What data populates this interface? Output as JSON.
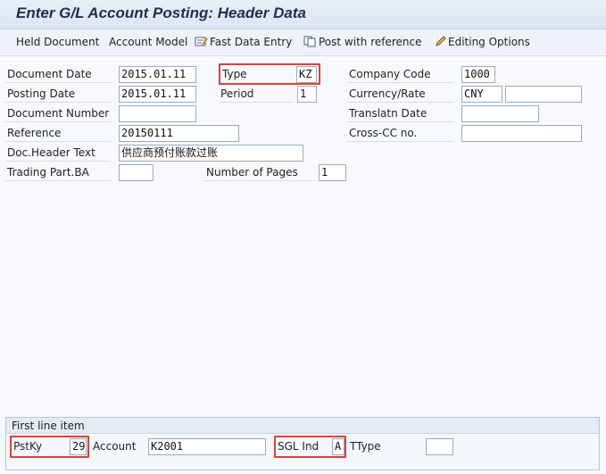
{
  "window": {
    "title": "Enter G/L Account Posting: Header Data"
  },
  "toolbar": {
    "held_document": "Held Document",
    "account_model": "Account Model",
    "fast_data_entry": "Fast Data Entry",
    "post_with_reference": "Post with reference",
    "editing_options": "Editing Options"
  },
  "header": {
    "document_date": {
      "label": "Document Date",
      "value": "2015.01.11"
    },
    "type": {
      "label": "Type",
      "value": "KZ"
    },
    "company_code": {
      "label": "Company Code",
      "value": "1000"
    },
    "posting_date": {
      "label": "Posting Date",
      "value": "2015.01.11"
    },
    "period": {
      "label": "Period",
      "value": "1"
    },
    "currency_rate": {
      "label": "Currency/Rate",
      "currency": "CNY",
      "rate": ""
    },
    "document_number": {
      "label": "Document Number",
      "value": ""
    },
    "translatn_date": {
      "label": "Translatn Date",
      "value": ""
    },
    "reference": {
      "label": "Reference",
      "value": "20150111"
    },
    "cross_cc_no": {
      "label": "Cross-CC no.",
      "value": ""
    },
    "doc_header_text": {
      "label": "Doc.Header Text",
      "value": "供应商预付账款过账"
    },
    "trading_part_ba": {
      "label": "Trading Part.BA",
      "value": ""
    },
    "number_of_pages": {
      "label": "Number of Pages",
      "value": "1"
    }
  },
  "first_line_item": {
    "title": "First line item",
    "pstky": {
      "label": "PstKy",
      "value": "29"
    },
    "account": {
      "label": "Account",
      "value": "K2001"
    },
    "sgl_ind": {
      "label": "SGL Ind",
      "value": "A"
    },
    "ttype": {
      "label": "TType",
      "value": ""
    }
  },
  "colors": {
    "highlight": "#d9423b",
    "title_text": "#1e2f4f",
    "toolbar_bg": "#eef3fa"
  }
}
